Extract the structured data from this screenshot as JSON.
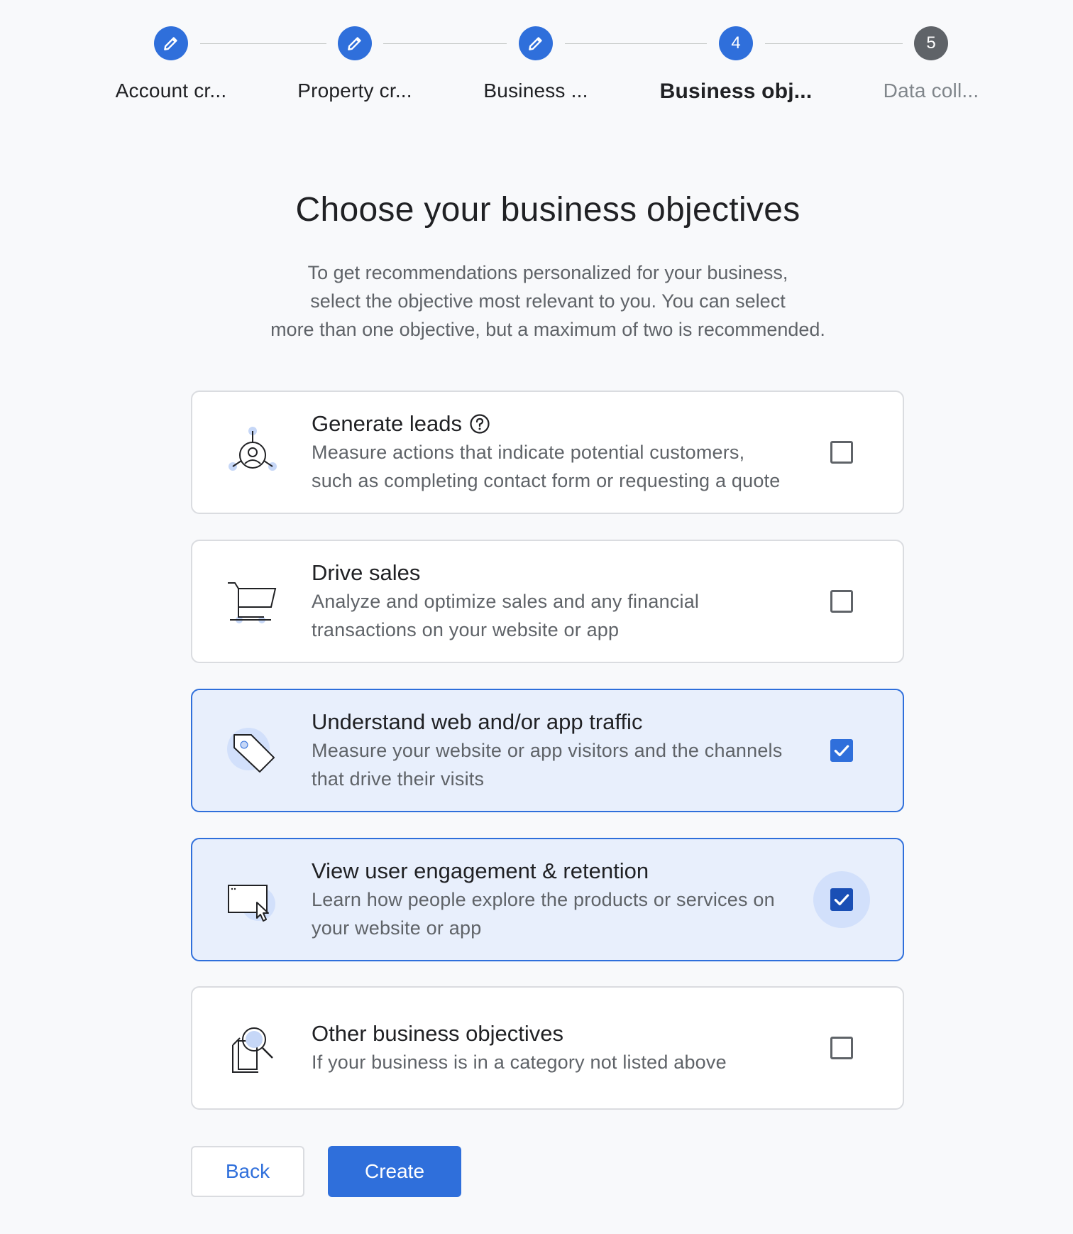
{
  "stepper": {
    "steps": [
      {
        "label": "Account cr...",
        "state": "done",
        "icon": "pencil-icon"
      },
      {
        "label": "Property cr...",
        "state": "done",
        "icon": "pencil-icon"
      },
      {
        "label": "Business ...",
        "state": "done",
        "icon": "pencil-icon"
      },
      {
        "label": "Business obj...",
        "state": "current",
        "number": "4"
      },
      {
        "label": "Data coll...",
        "state": "future",
        "number": "5"
      }
    ]
  },
  "page": {
    "title": "Choose your business objectives",
    "subtitle_lines": [
      "To get recommendations personalized for your business,",
      "select the objective most relevant to you. You can select",
      "more than one objective, but a maximum of two is recommended."
    ]
  },
  "objectives": [
    {
      "title": "Generate leads",
      "desc_lines": [
        "Measure actions that indicate potential customers,",
        "such as completing contact form or requesting a quote"
      ],
      "icon": "leads-icon",
      "help_icon": "help-circle-icon",
      "checked": false
    },
    {
      "title": "Drive sales",
      "desc_lines": [
        "Analyze and optimize sales and any financial",
        "transactions on your website or app"
      ],
      "icon": "shopping-cart-icon",
      "checked": false
    },
    {
      "title": "Understand web and/or app traffic",
      "desc_lines": [
        "Measure your website or app visitors and the channels",
        "that drive their visits"
      ],
      "icon": "tag-icon",
      "checked": true
    },
    {
      "title": "View user engagement & retention",
      "desc_lines": [
        "Learn how people explore the products or services on",
        "your website or app"
      ],
      "icon": "browser-cursor-icon",
      "checked": true,
      "focused": true
    },
    {
      "title": "Other business objectives",
      "desc_lines": [
        "If your business is in a category not listed above"
      ],
      "icon": "document-search-icon",
      "checked": false
    }
  ],
  "buttons": {
    "back": "Back",
    "create": "Create"
  },
  "colors": {
    "accent": "#2f6fdb",
    "selected_card_bg": "#e8effc",
    "future_step": "#5f6368",
    "background": "#f8f9fb"
  }
}
